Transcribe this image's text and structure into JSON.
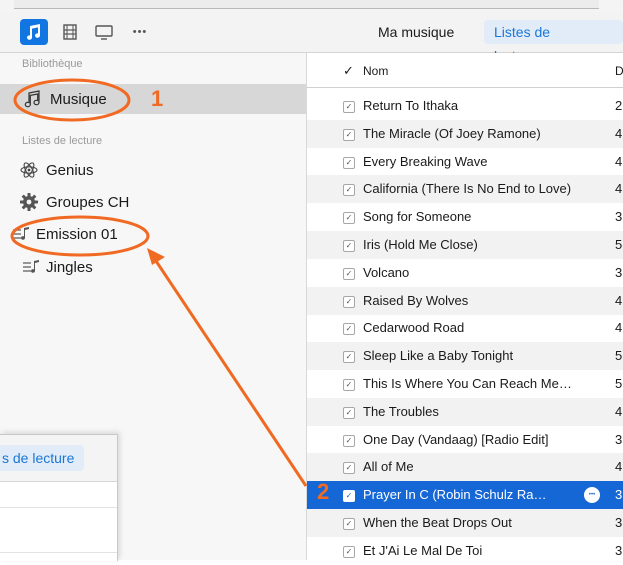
{
  "toolbar": {
    "view_icons": [
      "music-note-icon",
      "film-icon",
      "tv-icon",
      "more-icon"
    ],
    "more_glyph": "•••",
    "tabs": [
      {
        "label": "Ma musique",
        "selected": false
      },
      {
        "label": "Listes de lecture",
        "selected": true
      }
    ]
  },
  "sidebar": {
    "library_heading": "Bibliothèque",
    "library_items": [
      {
        "label": "Musique",
        "icon": "music-note-icon",
        "selected": true
      }
    ],
    "playlists_heading": "Listes de lecture",
    "playlist_items": [
      {
        "label": "Genius",
        "icon": "atom-icon"
      },
      {
        "label": "Groupes CH",
        "icon": "gear-icon"
      },
      {
        "label": "Emission 01",
        "icon": "playlist-icon"
      },
      {
        "label": "Jingles",
        "icon": "playlist-icon"
      }
    ]
  },
  "tracklist": {
    "header": {
      "check": "✓",
      "name": "Nom",
      "duration": "D"
    },
    "rows": [
      {
        "name": "Return To Ithaka",
        "duration": "2",
        "selected": false
      },
      {
        "name": "The Miracle (Of Joey Ramone)",
        "duration": "4",
        "selected": false
      },
      {
        "name": "Every Breaking Wave",
        "duration": "4",
        "selected": false
      },
      {
        "name": "California (There Is No End to Love)",
        "duration": "4",
        "selected": false
      },
      {
        "name": "Song for Someone",
        "duration": "3",
        "selected": false
      },
      {
        "name": "Iris (Hold Me Close)",
        "duration": "5",
        "selected": false
      },
      {
        "name": "Volcano",
        "duration": "3",
        "selected": false
      },
      {
        "name": "Raised By Wolves",
        "duration": "4",
        "selected": false
      },
      {
        "name": "Cedarwood Road",
        "duration": "4",
        "selected": false
      },
      {
        "name": "Sleep Like a Baby Tonight",
        "duration": "5",
        "selected": false
      },
      {
        "name": "This Is Where You Can Reach Me…",
        "duration": "5",
        "selected": false
      },
      {
        "name": "The Troubles",
        "duration": "4",
        "selected": false
      },
      {
        "name": "One Day (Vandaag) [Radio Edit]",
        "duration": "3",
        "selected": false
      },
      {
        "name": "All of Me",
        "duration": "4",
        "selected": false
      },
      {
        "name": "Prayer In C (Robin Schulz Ra…",
        "duration": "3",
        "selected": true
      },
      {
        "name": "When the Beat Drops Out",
        "duration": "3",
        "selected": false
      },
      {
        "name": "Et J'Ai Le Mal De Toi",
        "duration": "3",
        "selected": false
      }
    ],
    "check_glyph": "✓",
    "more_glyph": "•••"
  },
  "inset": {
    "tab_label": "s de lecture"
  },
  "annotations": {
    "step1": "1",
    "step2": "2",
    "color": "#f06a23"
  },
  "colors": {
    "accent": "#1175e2",
    "selected_row": "#1667d6",
    "annotation": "#f06a23"
  }
}
